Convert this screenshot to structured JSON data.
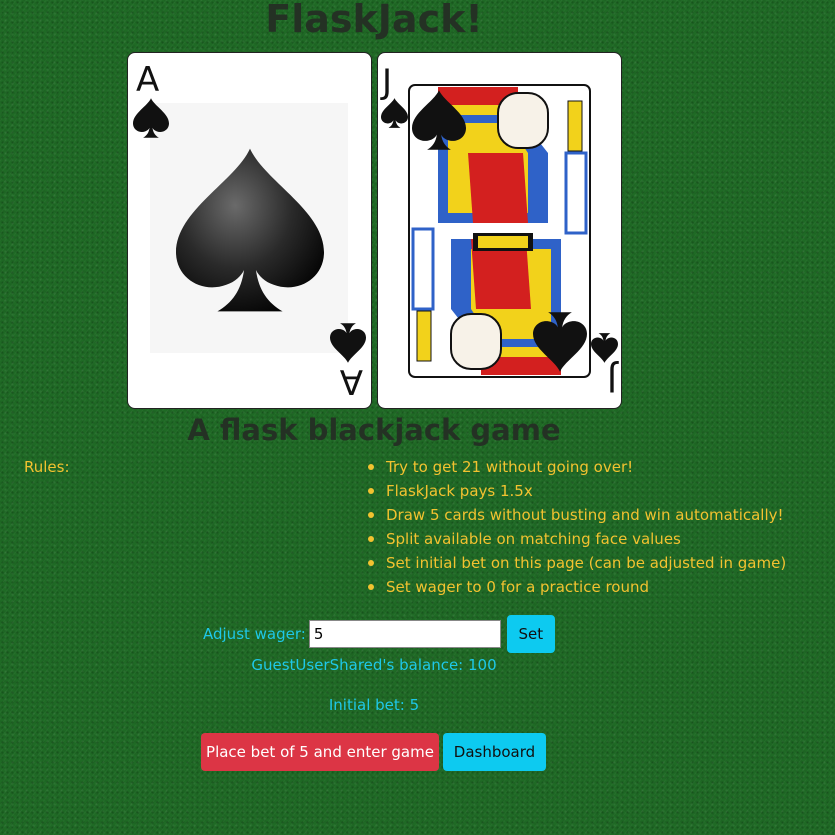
{
  "page": {
    "title": "FlaskJack!",
    "subtitle": "A flask blackjack game"
  },
  "cards": [
    {
      "rank": "A",
      "suit": "spades",
      "label": "A"
    },
    {
      "rank": "J",
      "suit": "spades",
      "label": "J"
    }
  ],
  "rules": {
    "label": "Rules:",
    "items": [
      "Try to get 21 without going over!",
      "FlaskJack pays 1.5x",
      "Draw 5 cards without busting and win automatically!",
      "Split available on matching face values",
      "Set initial bet on this page (can be adjusted in game)",
      "Set wager to 0 for a practice round"
    ]
  },
  "wager": {
    "label": "Adjust wager:",
    "value": "5",
    "set_button": "Set"
  },
  "balance_text": "GuestUserShared's balance: 100",
  "initial_bet_text": "Initial bet: 5",
  "actions": {
    "place_bet": "Place bet of 5 and enter game",
    "dashboard": "Dashboard"
  },
  "colors": {
    "felt": "#1f6a25",
    "rules_text": "#f2c230",
    "info_text": "#1ec8e8",
    "danger_button": "#dc3545",
    "info_button": "#0dcaf0"
  }
}
